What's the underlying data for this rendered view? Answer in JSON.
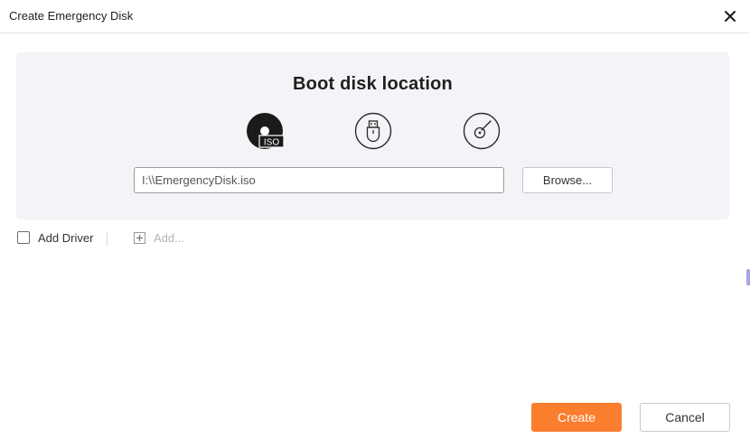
{
  "window": {
    "title": "Create Emergency Disk"
  },
  "boot_panel": {
    "heading": "Boot disk location",
    "options": [
      {
        "name": "iso",
        "icon": "iso-disc-icon",
        "badge": "ISO",
        "selected": true
      },
      {
        "name": "usb",
        "icon": "usb-drive-icon",
        "selected": false
      },
      {
        "name": "cd",
        "icon": "cd-dvd-icon",
        "selected": false
      }
    ],
    "path_value": "I:\\\\EmergencyDisk.iso",
    "browse_label": "Browse..."
  },
  "driver": {
    "add_driver_label": "Add Driver",
    "add_label": "Add...",
    "checked": false
  },
  "footer": {
    "create_label": "Create",
    "cancel_label": "Cancel"
  },
  "colors": {
    "accent": "#fb7d2e",
    "panel_bg": "#f3f4f7",
    "icon_dark": "#1a1a1a",
    "disabled_text": "#b5b5b5"
  }
}
